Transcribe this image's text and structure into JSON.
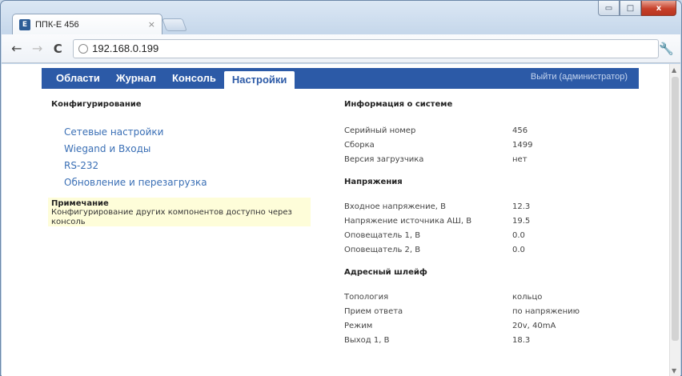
{
  "browser": {
    "tab_title": "ППК-Е 456",
    "tab_favicon": "Е",
    "url": "192.168.0.199",
    "window_controls": {
      "minimize": "▭",
      "maximize": "□",
      "close": "x"
    }
  },
  "nav": {
    "items": [
      "Области",
      "Журнал",
      "Консоль",
      "Настройки"
    ],
    "active": "Настройки",
    "logout": "Выйти (администратор)"
  },
  "config": {
    "title": "Конфигурирование",
    "links": [
      "Сетевые настройки",
      "Wiegand и Входы",
      "RS-232",
      "Обновление и перезагрузка"
    ],
    "note_title": "Примечание",
    "note_text": "Конфигурирование других компонентов доступно через консоль"
  },
  "system": {
    "title": "Информация о системе",
    "rows": [
      {
        "k": "Серийный номер",
        "v": "456"
      },
      {
        "k": "Сборка",
        "v": "1499"
      },
      {
        "k": "Версия загрузчика",
        "v": "нет"
      }
    ]
  },
  "voltages": {
    "title": "Напряжения",
    "rows": [
      {
        "k": "Входное напряжение, В",
        "v": "12.3"
      },
      {
        "k": "Напряжение источника АШ, В",
        "v": "19.5"
      },
      {
        "k": "Оповещатель 1, В",
        "v": "0.0"
      },
      {
        "k": "Оповещатель 2, В",
        "v": "0.0"
      }
    ]
  },
  "loop": {
    "title": "Адресный шлейф",
    "rows": [
      {
        "k": "Топология",
        "v": "кольцо"
      },
      {
        "k": "Прием ответа",
        "v": "по напряжению"
      },
      {
        "k": "Режим",
        "v": "20v, 40mA"
      },
      {
        "k": "Выход 1, В",
        "v": "18.3"
      }
    ]
  },
  "colors": {
    "nav_bg": "#2c5aa7",
    "link": "#3a6fb5",
    "note_bg": "#fefdd9"
  }
}
